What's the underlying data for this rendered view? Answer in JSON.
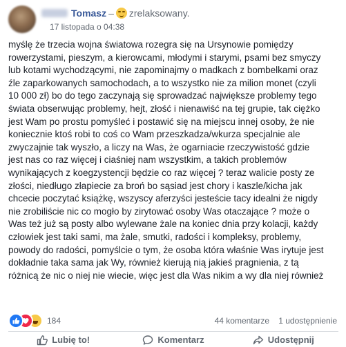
{
  "post": {
    "author": "Tomasz",
    "separator": "–",
    "feeling": "zrelaksowany.",
    "timestamp": "17 listopada o 04:38",
    "lines": [
      "myślę że trzecia wojna światowa rozegra się na Ursynowie pomiędzy",
      "rowerzystami, pieszym, a kierowcami, młodymi i starymi, psami bez smyczy",
      "lub kotami wychodzącymi, nie zapominajmy o madkach z bombelkami oraz",
      "źle zaparkowanych samochodach, a to wszystko nie za milion monet (czyli",
      "10 000 zł) bo do tego zaczynają się sprowadzać największe problemy tego",
      "świata obserwując problemy, hejt, złość i nienawiść na tej grupie, tak ciężko",
      "jest Wam po prostu pomyśleć i postawić się na miejscu innej osoby, że nie",
      "koniecznie ktoś robi to coś co Wam przeszkadza/wkurza specjalnie ale",
      "zwyczajnie tak wyszło, a liczy na Was, że ogarniacie rzeczywistość gdzie",
      "jest nas co raz więcej i ciaśniej nam wszystkim, a takich problemów",
      "wynikających z koegzystencji będzie co raz więcej ? teraz walicie posty ze",
      "złości, niedługo złapiecie za broń bo sąsiad jest chory i kaszle/kicha jak",
      "chcecie poczytać książkę, wszyscy aferzyści jesteście tacy idealni że nigdy",
      "nie zrobiliście nic co mogło by zirytować osoby Was otaczające ? może o",
      "Was też już są posty albo wylewane żale na koniec dnia przy kolacji, każdy",
      "człowiek jest taki sami, ma żale, smutki, radości i kompleksy, problemy,",
      "powody do radości, pomyślcie o tym, że osoba która właśnie Was irytuje jest",
      "dokładnie taka sama jak Wy, również kierują nią jakieś pragnienia, z tą",
      "różnicą że nic o niej nie wiecie, więc jest dla Was nikim a wy dla niej również"
    ]
  },
  "stats": {
    "reaction_count": "184",
    "comments": "44 komentarze",
    "shares": "1 udostępnienie"
  },
  "actions": {
    "like": "Lubię to!",
    "comment": "Komentarz",
    "share": "Udostępnij"
  },
  "icons": {
    "reaction_like": "thumbs-up-icon",
    "reaction_love": "heart-icon",
    "reaction_haha": "laughing-face-icon",
    "feeling": "relieved-face-icon"
  },
  "colors": {
    "author": "#385898",
    "like_reaction": "#2078f4",
    "love_reaction": "#f0284a",
    "haha_reaction": "#f7c948",
    "muted_text": "#606770"
  }
}
